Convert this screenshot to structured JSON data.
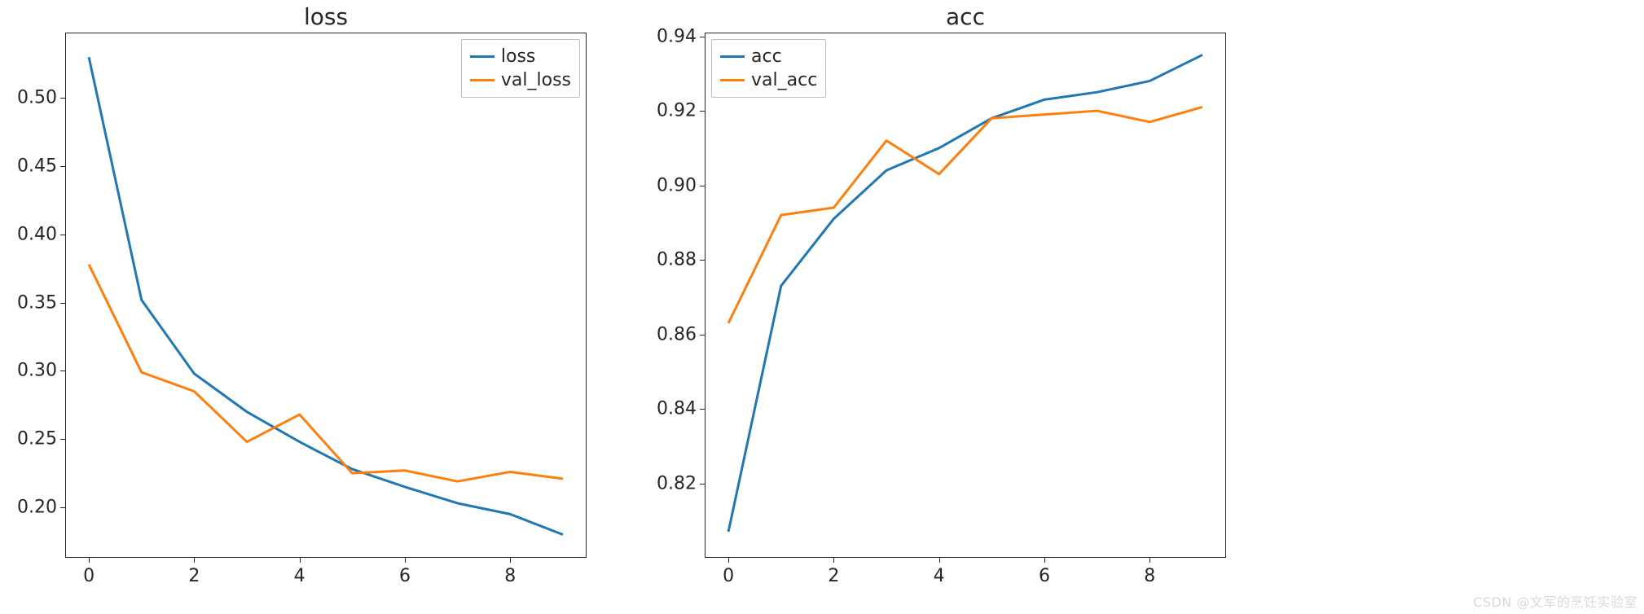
{
  "chart_data": [
    {
      "type": "line",
      "title": "loss",
      "xlabel": "",
      "ylabel": "",
      "xlim": [
        -0.45,
        9.45
      ],
      "ylim": [
        0.163,
        0.548
      ],
      "xticks": [
        0,
        2,
        4,
        6,
        8
      ],
      "yticks": [
        0.2,
        0.25,
        0.3,
        0.35,
        0.4,
        0.45,
        0.5
      ],
      "legend_position": "top-right",
      "x": [
        0,
        1,
        2,
        3,
        4,
        5,
        6,
        7,
        8,
        9
      ],
      "series": [
        {
          "name": "loss",
          "color": "#1f77b4",
          "values": [
            0.53,
            0.352,
            0.298,
            0.27,
            0.248,
            0.228,
            0.215,
            0.203,
            0.195,
            0.18
          ]
        },
        {
          "name": "val_loss",
          "color": "#ff7f0e",
          "values": [
            0.378,
            0.299,
            0.285,
            0.248,
            0.268,
            0.225,
            0.227,
            0.219,
            0.226,
            0.221
          ]
        }
      ]
    },
    {
      "type": "line",
      "title": "acc",
      "xlabel": "",
      "ylabel": "",
      "xlim": [
        -0.45,
        9.45
      ],
      "ylim": [
        0.8,
        0.941
      ],
      "xticks": [
        0,
        2,
        4,
        6,
        8
      ],
      "yticks": [
        0.82,
        0.84,
        0.86,
        0.88,
        0.9,
        0.92,
        0.94
      ],
      "legend_position": "top-left",
      "x": [
        0,
        1,
        2,
        3,
        4,
        5,
        6,
        7,
        8,
        9
      ],
      "series": [
        {
          "name": "acc",
          "color": "#1f77b4",
          "values": [
            0.807,
            0.873,
            0.891,
            0.904,
            0.91,
            0.918,
            0.923,
            0.925,
            0.928,
            0.935
          ]
        },
        {
          "name": "val_acc",
          "color": "#ff7f0e",
          "values": [
            0.863,
            0.892,
            0.894,
            0.912,
            0.903,
            0.918,
            0.919,
            0.92,
            0.917,
            0.921
          ]
        }
      ]
    }
  ],
  "watermark": "CSDN @文军的烹饪实验室"
}
